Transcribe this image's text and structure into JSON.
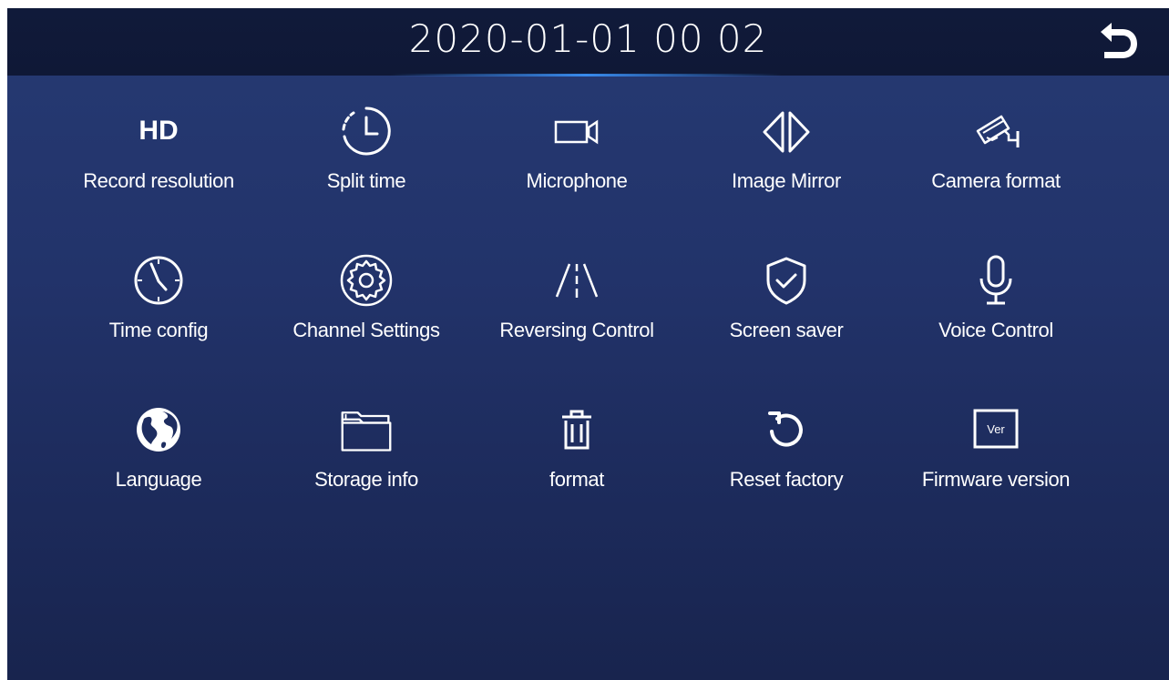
{
  "header": {
    "datetime": "2020-01-01  00 02",
    "back_icon": "return-arrow-icon"
  },
  "menu": [
    {
      "label": "Record resolution",
      "icon": "hd-icon",
      "icon_text": "HD"
    },
    {
      "label": "Split time",
      "icon": "clock-split-icon"
    },
    {
      "label": "Microphone",
      "icon": "video-camera-icon"
    },
    {
      "label": "Image Mirror",
      "icon": "mirror-arrows-icon"
    },
    {
      "label": "Camera format",
      "icon": "cctv-camera-icon"
    },
    {
      "label": "Time config",
      "icon": "clock-icon"
    },
    {
      "label": "Channel Settings",
      "icon": "gear-icon"
    },
    {
      "label": "Reversing Control",
      "icon": "road-lanes-icon"
    },
    {
      "label": "Screen saver",
      "icon": "shield-check-icon"
    },
    {
      "label": "Voice Control",
      "icon": "microphone-icon"
    },
    {
      "label": "Language",
      "icon": "globe-icon"
    },
    {
      "label": "Storage info",
      "icon": "folder-icon"
    },
    {
      "label": "format",
      "icon": "trash-icon"
    },
    {
      "label": "Reset factory",
      "icon": "reset-icon"
    },
    {
      "label": "Firmware version",
      "icon": "version-icon",
      "icon_text": "Ver"
    }
  ],
  "colors": {
    "background": "#22336a",
    "topbar": "#0f1836",
    "accent_glow": "#3c96ff",
    "text": "#ffffff"
  }
}
